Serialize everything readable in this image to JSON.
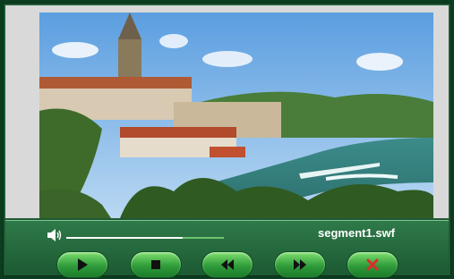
{
  "player": {
    "filename": "segment1.swf",
    "seek_progress": 0.74
  },
  "controls": {
    "icons": [
      "play-icon",
      "stop-icon",
      "rewind-icon",
      "fast-forward-icon",
      "close-icon"
    ]
  },
  "colors": {
    "panel": "#1f5a34",
    "button_top": "#7fe06f",
    "button_bottom": "#1b7a2a",
    "close_icon": "#e02a2a"
  }
}
